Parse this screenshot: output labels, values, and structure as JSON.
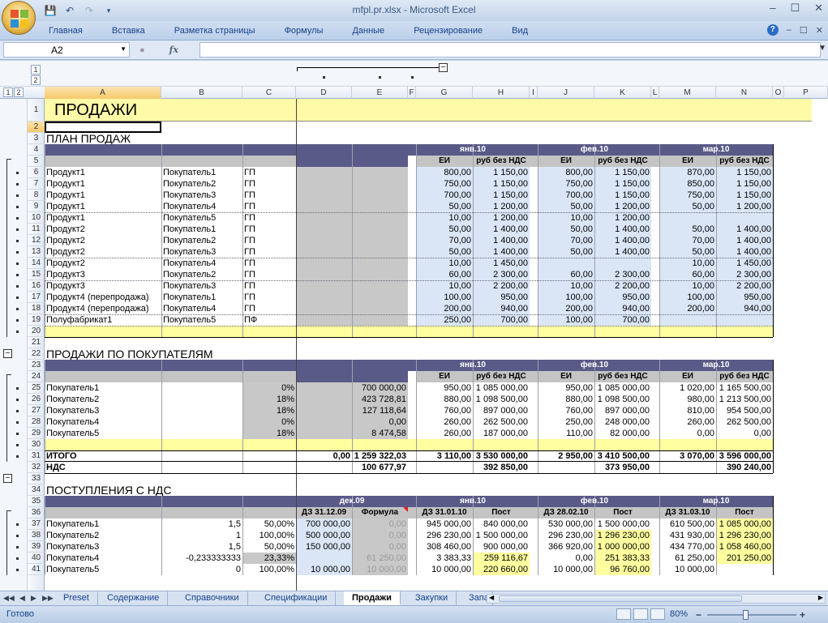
{
  "window": {
    "title": "mfpl.pr.xlsx - Microsoft Excel",
    "controls": [
      "–",
      "☐",
      "✕"
    ]
  },
  "ribbon": {
    "tabs": [
      "Главная",
      "Вставка",
      "Разметка страницы",
      "Формулы",
      "Данные",
      "Рецензирование",
      "Вид"
    ],
    "help": "?",
    "win_controls": [
      "–",
      "☐",
      "✕"
    ]
  },
  "formula_bar": {
    "name_box": "A2",
    "fx": "fx",
    "value": ""
  },
  "outline": {
    "levels_top": [
      "1",
      "2"
    ],
    "levels_left": [
      "1",
      "2"
    ]
  },
  "columns": [
    "A",
    "B",
    "C",
    "D",
    "E",
    "F",
    "G",
    "H",
    "I",
    "J",
    "K",
    "L",
    "M",
    "N",
    "O",
    "P"
  ],
  "rows": [
    "1",
    "2",
    "3",
    "4",
    "5",
    "6",
    "7",
    "8",
    "9",
    "10",
    "11",
    "12",
    "13",
    "14",
    "15",
    "16",
    "17",
    "18",
    "19",
    "20",
    "21",
    "22",
    "23",
    "24",
    "25",
    "26",
    "27",
    "28",
    "29",
    "30",
    "31",
    "32",
    "33",
    "34",
    "35",
    "36",
    "37",
    "38",
    "39",
    "40",
    "41"
  ],
  "sheet": {
    "title": "ПРОДАЖИ",
    "sec1": "ПЛАН ПРОДАЖ",
    "sec2": "ПРОДАЖИ ПО ПОКУПАТЕЛЯМ",
    "sec3": "ПОСТУПЛЕНИЯ С НДС",
    "months": [
      "янв.10",
      "фев.10",
      "мар.10"
    ],
    "ei": "ЕИ",
    "rub": "руб без НДС",
    "plan": [
      [
        "Продукт1",
        "Покупатель1",
        "ГП",
        "800,00",
        "1 150,00",
        "800,00",
        "1 150,00",
        "870,00",
        "1 150,00"
      ],
      [
        "Продукт1",
        "Покупатель2",
        "ГП",
        "750,00",
        "1 150,00",
        "750,00",
        "1 150,00",
        "850,00",
        "1 150,00"
      ],
      [
        "Продукт1",
        "Покупатель3",
        "ГП",
        "700,00",
        "1 150,00",
        "700,00",
        "1 150,00",
        "750,00",
        "1 150,00"
      ],
      [
        "Продукт1",
        "Покупатель4",
        "ГП",
        "50,00",
        "1 200,00",
        "50,00",
        "1 200,00",
        "50,00",
        "1 200,00"
      ],
      [
        "Продукт1",
        "Покупатель5",
        "ГП",
        "10,00",
        "1 200,00",
        "10,00",
        "1 200,00",
        "",
        ""
      ],
      [
        "Продукт2",
        "Покупатель1",
        "ГП",
        "50,00",
        "1 400,00",
        "50,00",
        "1 400,00",
        "50,00",
        "1 400,00"
      ],
      [
        "Продукт2",
        "Покупатель2",
        "ГП",
        "70,00",
        "1 400,00",
        "70,00",
        "1 400,00",
        "70,00",
        "1 400,00"
      ],
      [
        "Продукт2",
        "Покупатель3",
        "ГП",
        "50,00",
        "1 400,00",
        "50,00",
        "1 400,00",
        "50,00",
        "1 400,00"
      ],
      [
        "Продукт2",
        "Покупатель4",
        "ГП",
        "10,00",
        "1 450,00",
        "",
        "",
        "10,00",
        "1 450,00"
      ],
      [
        "Продукт3",
        "Покупатель2",
        "ГП",
        "60,00",
        "2 300,00",
        "60,00",
        "2 300,00",
        "60,00",
        "2 300,00"
      ],
      [
        "Продукт3",
        "Покупатель3",
        "ГП",
        "10,00",
        "2 200,00",
        "10,00",
        "2 200,00",
        "10,00",
        "2 200,00"
      ],
      [
        "Продукт4 (перепродажа)",
        "Покупатель1",
        "ГП",
        "100,00",
        "950,00",
        "100,00",
        "950,00",
        "100,00",
        "950,00"
      ],
      [
        "Продукт4 (перепродажа)",
        "Покупатель4",
        "ГП",
        "200,00",
        "940,00",
        "200,00",
        "940,00",
        "200,00",
        "940,00"
      ],
      [
        "Полуфабрикат1",
        "Покупатель5",
        "ПФ",
        "250,00",
        "700,00",
        "100,00",
        "700,00",
        "",
        ""
      ]
    ],
    "buyers": [
      [
        "Покупатель1",
        "0%",
        "700 000,00",
        "950,00",
        "1 085 000,00",
        "950,00",
        "1 085 000,00",
        "1 020,00",
        "1 165 500,00"
      ],
      [
        "Покупатель2",
        "18%",
        "423 728,81",
        "880,00",
        "1 098 500,00",
        "880,00",
        "1 098 500,00",
        "980,00",
        "1 213 500,00"
      ],
      [
        "Покупатель3",
        "18%",
        "127 118,64",
        "760,00",
        "897 000,00",
        "760,00",
        "897 000,00",
        "810,00",
        "954 500,00"
      ],
      [
        "Покупатель4",
        "0%",
        "0,00",
        "260,00",
        "262 500,00",
        "250,00",
        "248 000,00",
        "260,00",
        "262 500,00"
      ],
      [
        "Покупатель5",
        "18%",
        "8 474,58",
        "260,00",
        "187 000,00",
        "110,00",
        "82 000,00",
        "0,00",
        "0,00"
      ]
    ],
    "total": {
      "label": "ИТОГО",
      "d": "0,00",
      "e": "1 259 322,03",
      "g": "3 110,00",
      "h": "3 530 000,00",
      "j": "2 950,00",
      "k": "3 410 500,00",
      "m": "3 070,00",
      "n": "3 596 000,00"
    },
    "vat": {
      "label": "НДС",
      "e": "100 677,97",
      "h": "392 850,00",
      "k": "373 950,00",
      "n": "390 240,00"
    },
    "dec09": "дек.09",
    "receipts_hdr": [
      "ДЗ 31.12.09",
      "Формула",
      "ДЗ 31.01.10",
      "Пост",
      "ДЗ 28.02.10",
      "Пост",
      "ДЗ 31.03.10",
      "Пост"
    ],
    "receipts": [
      [
        "Покупатель1",
        "1,5",
        "50,00%",
        "700 000,00",
        "0,00",
        "945 000,00",
        "840 000,00",
        "530 000,00",
        "1 500 000,00",
        "610 500,00",
        "1 085 000,00"
      ],
      [
        "Покупатель2",
        "1",
        "100,00%",
        "500 000,00",
        "0,00",
        "296 230,00",
        "1 500 000,00",
        "296 230,00",
        "1 296 230,00",
        "431 930,00",
        "1 296 230,00"
      ],
      [
        "Покупатель3",
        "1,5",
        "50,00%",
        "150 000,00",
        "0,00",
        "308 460,00",
        "900 000,00",
        "366 920,00",
        "1 000 000,00",
        "434 770,00",
        "1 058 460,00"
      ],
      [
        "Покупатель4",
        "-0,233333333",
        "23,33%",
        "",
        "61 250,00",
        "3 383,33",
        "259 116,67",
        "0,00",
        "251 383,33",
        "61 250,00",
        "201 250,00"
      ],
      [
        "Покупатель5",
        "0",
        "100,00%",
        "10 000,00",
        "10 000,00",
        "10 000,00",
        "220 660,00",
        "10 000,00",
        "96 760,00",
        "10 000,00",
        ""
      ]
    ]
  },
  "sheet_tabs": [
    "Preset",
    "Содержание",
    "Справочники",
    "Спецификации",
    "Продажи",
    "Закупки",
    "Запа"
  ],
  "active_tab": "Продажи",
  "status": {
    "ready": "Готово",
    "zoom": "80%"
  }
}
